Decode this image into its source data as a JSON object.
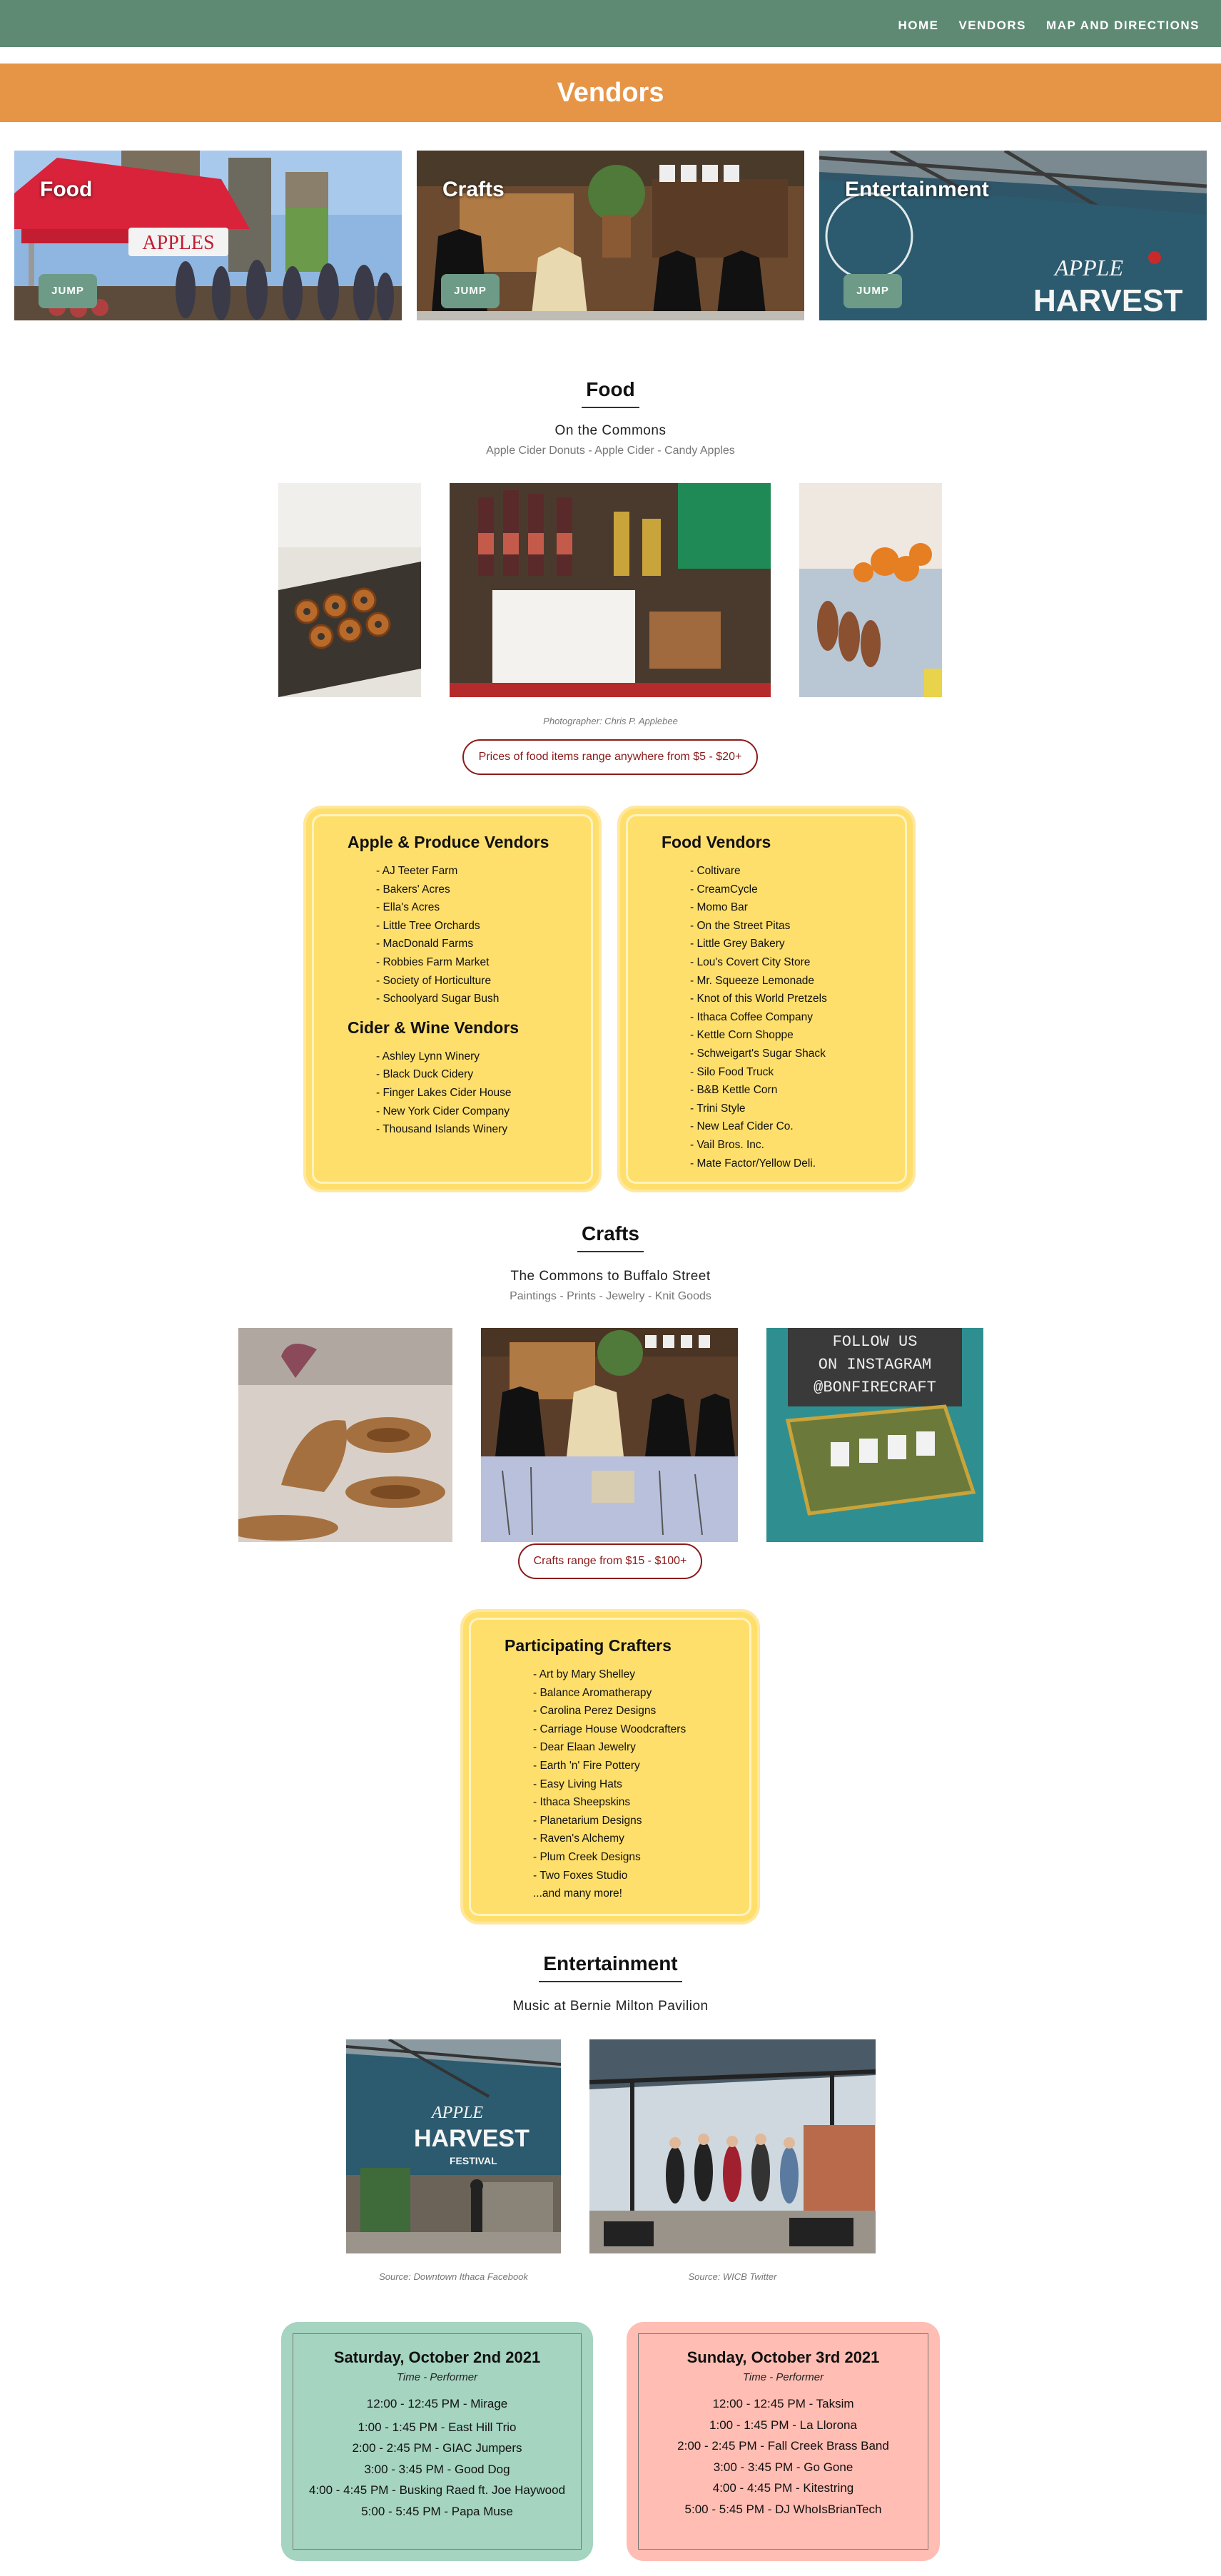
{
  "nav": {
    "links": [
      "HOME",
      "VENDORS",
      "MAP AND DIRECTIONS"
    ]
  },
  "banner": {
    "title": "Vendors"
  },
  "heroes": [
    {
      "title": "Food",
      "jump": "JUMP"
    },
    {
      "title": "Crafts",
      "jump": "JUMP"
    },
    {
      "title": "Entertainment",
      "jump": "JUMP"
    }
  ],
  "food": {
    "title": "Food",
    "location": "On the Commons",
    "tags": "Apple Cider Donuts - Apple Cider - Candy Apples",
    "photo_credit": "Photographer: Chris P. Applebee",
    "price_note": "Prices of food items range anywhere from $5 - $20+",
    "apple_title": "Apple & Produce Vendors",
    "apple_vendors": [
      "- AJ Teeter Farm",
      "- Bakers' Acres",
      "- Ella's Acres",
      "- Little Tree Orchards",
      "- MacDonald Farms",
      "- Robbies Farm Market",
      "- Society of Horticulture",
      "- Schoolyard Sugar Bush"
    ],
    "cider_title": "Cider & Wine Vendors",
    "cider_vendors": [
      "- Ashley Lynn Winery",
      "- Black Duck Cidery",
      "- Finger Lakes Cider House",
      "- New York Cider Company",
      "- Thousand Islands Winery"
    ],
    "food_title": "Food Vendors",
    "food_vendors": [
      "- Coltivare",
      "- CreamCycle",
      "- Momo Bar",
      "- On the Street Pitas",
      "- Little Grey Bakery",
      "- Lou's Covert City Store",
      "- Mr. Squeeze Lemonade",
      "- Knot of this World Pretzels",
      "- Ithaca Coffee Company",
      "- Kettle Corn Shoppe",
      "- Schweigart's Sugar Shack",
      "- Silo Food Truck",
      "- B&B Kettle Corn",
      "- Trini Style",
      "- New Leaf Cider Co.",
      "- Vail Bros. Inc.",
      "- Mate Factor/Yellow Deli."
    ]
  },
  "crafts": {
    "title": "Crafts",
    "location": "The Commons to Buffalo Street",
    "tags": "Paintings - Prints - Jewelry - Knit Goods",
    "price_note": "Crafts range from $15 - $100+",
    "list_title": "Participating Crafters",
    "crafters": [
      "- Art by Mary Shelley",
      "- Balance Aromatherapy",
      "- Carolina Perez Designs",
      "- Carriage House Woodcrafters",
      "- Dear Elaan Jewelry",
      "- Earth 'n' Fire Pottery",
      "- Easy Living Hats",
      "- Ithaca Sheepskins",
      "- Planetarium Designs",
      "- Raven's Alchemy",
      "- Plum Creek Designs",
      "- Two Foxes Studio",
      "...and many more!"
    ],
    "sign_text": [
      "FOLLOW US",
      "ON INSTAGRAM",
      "@BONFIRECRAFT"
    ]
  },
  "entertainment": {
    "title": "Entertainment",
    "location": "Music at Bernie Milton Pavilion",
    "caption1": "Source: Downtown Ithaca Facebook",
    "caption2": "Source: WICB Twitter",
    "banner_text": [
      "APPLE",
      "HARVEST",
      "FESTIVAL"
    ],
    "saturday": {
      "title": "Saturday, October 2nd 2021",
      "subtitle": "Time - Performer",
      "items": [
        "12:00 - 12:45 PM - Mirage",
        "1:00 - 1:45 PM - East Hill Trio",
        "2:00 - 2:45 PM - GIAC Jumpers",
        "3:00 - 3:45 PM - Good Dog",
        "4:00 - 4:45 PM - Busking Raed ft. Joe Haywood",
        "5:00 - 5:45 PM - Papa Muse"
      ]
    },
    "sunday": {
      "title": "Sunday, October 3rd 2021",
      "subtitle": "Time - Performer",
      "items": [
        "12:00 - 12:45 PM - Taksim",
        "1:00 - 1:45 PM - La Llorona",
        "2:00 - 2:45 PM - Fall Creek Brass Band",
        "3:00 - 3:45 PM - Go Gone",
        "4:00 - 4:45 PM - Kitestring",
        "5:00 - 5:45 PM - DJ WhoIsBrianTech"
      ]
    }
  },
  "hero_sign_text": "APPLES",
  "colors": {
    "nav": "#5e8a74",
    "banner": "#e69446",
    "jump": "#6d9b88",
    "card": "#ffdf6b",
    "saturday": "#a5d4c1",
    "sunday": "#ffbdb3",
    "pill": "#8b1a1a"
  }
}
